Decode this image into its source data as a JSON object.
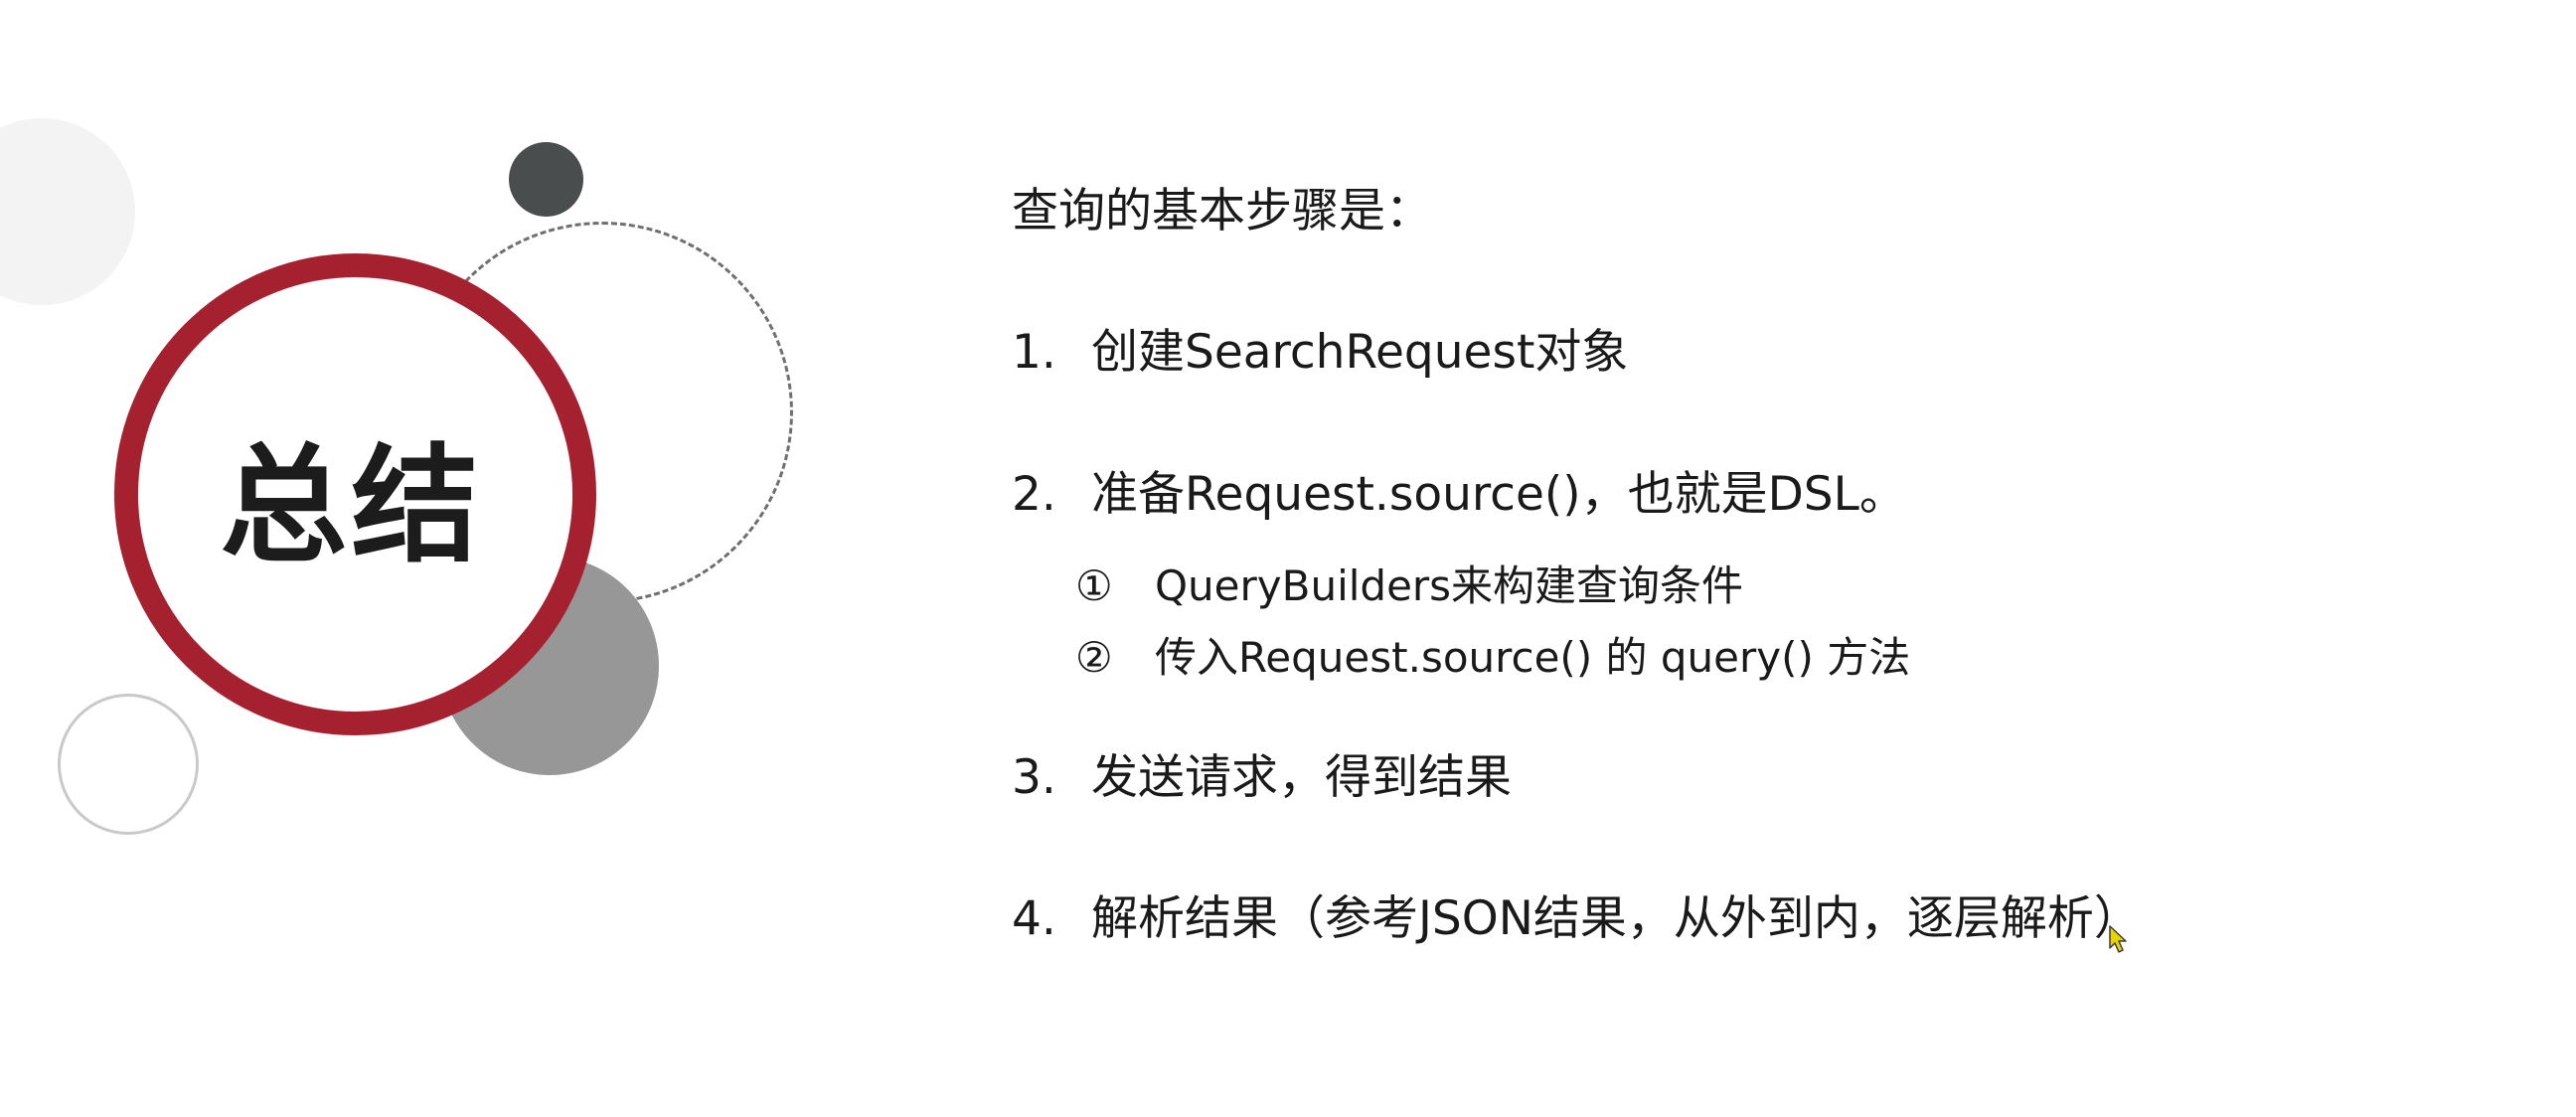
{
  "slide": {
    "title": "总结",
    "heading": "查询的基本步骤是：",
    "steps": [
      {
        "number": "1.",
        "text": "创建SearchRequest对象"
      },
      {
        "number": "2.",
        "text": "准备Request.source()，也就是DSL。",
        "substeps": [
          {
            "marker": "①",
            "text": "QueryBuilders来构建查询条件"
          },
          {
            "marker": "②",
            "text": "传入Request.source() 的 query() 方法"
          }
        ]
      },
      {
        "number": "3.",
        "text": "发送请求，得到结果"
      },
      {
        "number": "4.",
        "text": "解析结果（参考JSON结果，从外到内，逐层解析）"
      }
    ]
  },
  "colors": {
    "accent_ring": "#a5212f",
    "dark_dot": "#4a4d4e",
    "gray_disc": "#979797"
  },
  "icons": {
    "cursor": "mouse-pointer-icon"
  }
}
